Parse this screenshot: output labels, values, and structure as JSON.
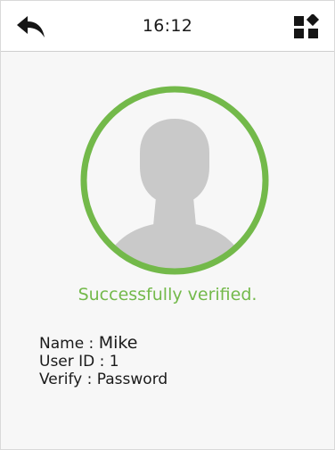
{
  "header": {
    "time": "16:12",
    "back_icon": "back-arrow-icon",
    "menu_icon": "grid-menu-icon"
  },
  "verification": {
    "status": "Successfully verified.",
    "status_color": "#73b94a",
    "avatar_icon": "user-silhouette-icon"
  },
  "user": {
    "name_label": "Name :",
    "name_value": "Mike",
    "user_id_label": "User ID :",
    "user_id_value": "1",
    "verify_label": "Verify :",
    "verify_value": "Password"
  }
}
